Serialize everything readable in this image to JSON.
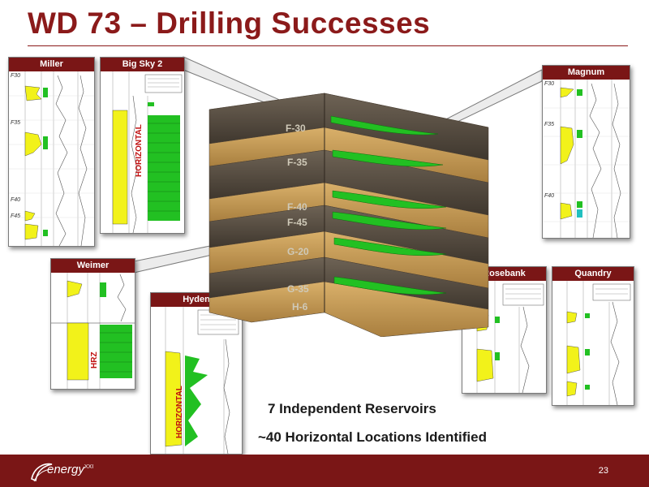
{
  "title": "WD 73 – Drilling Successes",
  "panels": {
    "miller": "Miller",
    "bigsky": "Big Sky 2",
    "magnum": "Magnum",
    "weimer": "Weimer",
    "hyden": "Hyden",
    "rosebank": "Rosebank",
    "quandry": "Quandry"
  },
  "log_markers": {
    "miller": [
      "F30",
      "F35",
      "F40",
      "F45"
    ],
    "magnum": [
      "F30",
      "F35",
      "F40"
    ]
  },
  "log_vertical_labels": {
    "bigsky": "HORIZONTAL",
    "hyden": "HORIZONTAL",
    "weimer": "HRZ"
  },
  "layers": [
    "F-30",
    "F-35",
    "F-40",
    "F-45",
    "G-20",
    "G-35",
    "H-6"
  ],
  "captions": {
    "reservoirs": "7 Independent Reservoirs",
    "locations": "~40 Horizontal Locations Identified"
  },
  "footer": {
    "logo": "energy",
    "logo_sup": "XXI",
    "page_number": "23"
  },
  "colors": {
    "brand": "#7a1616",
    "reservoir": "#22c022",
    "log_yellow": "#f2f21a"
  }
}
